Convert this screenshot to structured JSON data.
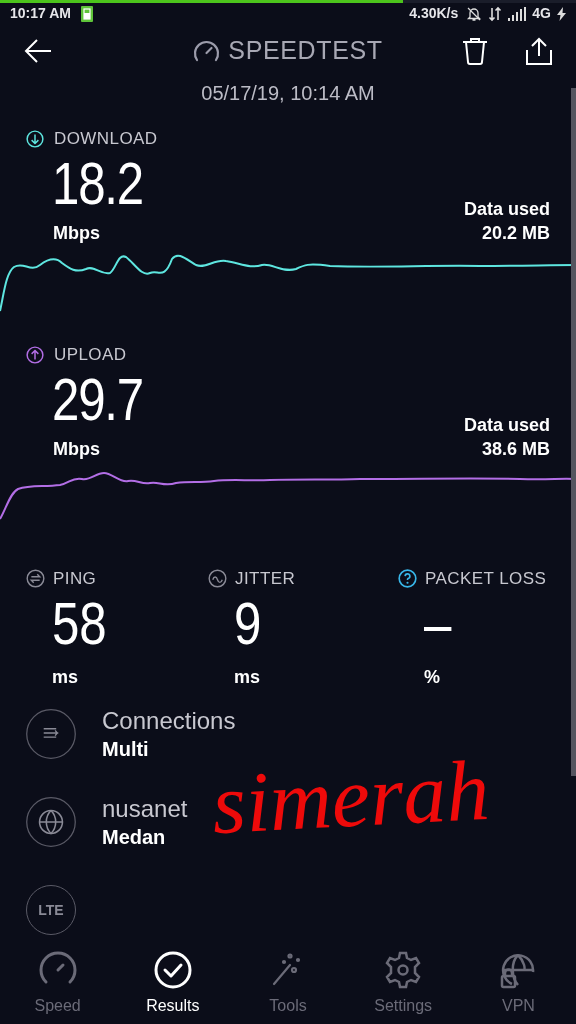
{
  "status_bar": {
    "time": "10:17 AM",
    "speed": "4.30K/s",
    "network": "4G",
    "progress": {
      "level": 0.7
    }
  },
  "header": {
    "title": "SPEEDTEST",
    "date": "05/17/19, 10:14 AM"
  },
  "results": [
    {
      "kind": "download",
      "label": "DOWNLOAD",
      "value": "18.2",
      "unit": "Mbps",
      "data_label": "Data used",
      "data_value": "20.2 MB"
    },
    {
      "kind": "upload",
      "label": "UPLOAD",
      "value": "29.7",
      "unit": "Mbps",
      "data_label": "Data used",
      "data_value": "38.6 MB"
    }
  ],
  "stats": [
    {
      "kind": "ping",
      "label": "PING",
      "value": "58",
      "unit": "ms"
    },
    {
      "kind": "jitter",
      "label": "JITTER",
      "value": "9",
      "unit": "ms"
    },
    {
      "kind": "loss",
      "label": "PACKET LOSS",
      "value": "–",
      "unit": "%"
    }
  ],
  "details": [
    {
      "kind": "connections",
      "title": "Connections",
      "value": "Multi"
    },
    {
      "kind": "provider",
      "title": "nusanet",
      "value": "Medan"
    },
    {
      "kind": "lte",
      "title": "LTE"
    }
  ],
  "annotation": "simerah",
  "nav": [
    {
      "kind": "speed",
      "label": "Speed",
      "selected": false
    },
    {
      "kind": "results",
      "label": "Results",
      "selected": true
    },
    {
      "kind": "tools",
      "label": "Tools",
      "selected": false
    },
    {
      "kind": "settings",
      "label": "Settings",
      "selected": false
    },
    {
      "kind": "vpn",
      "label": "VPN",
      "selected": false
    }
  ]
}
